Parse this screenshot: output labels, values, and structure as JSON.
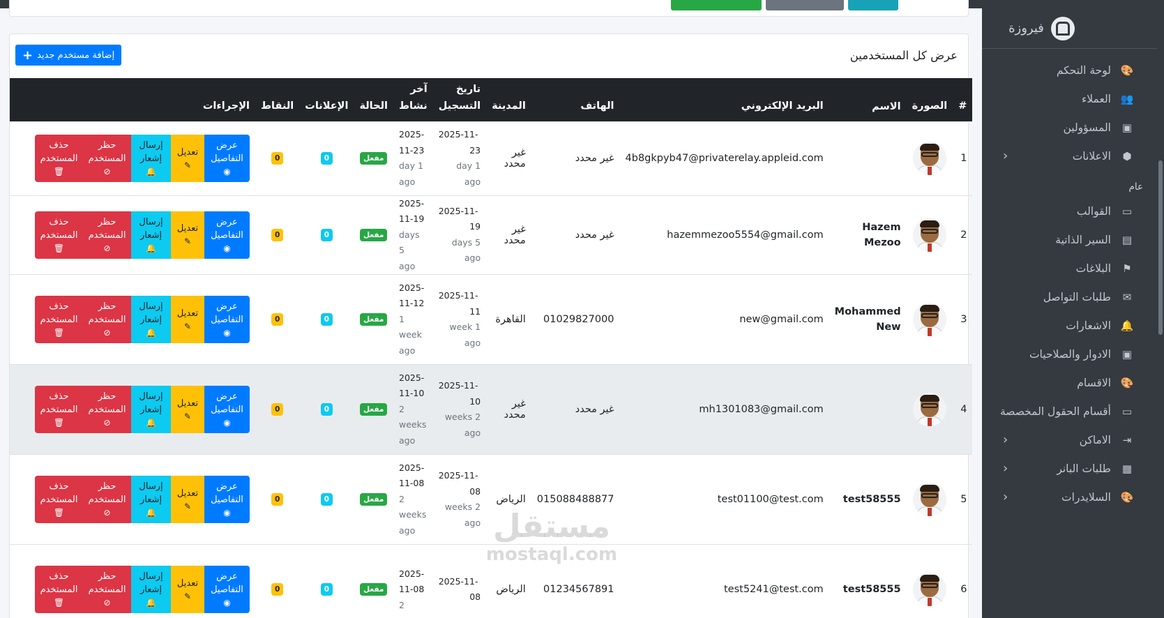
{
  "brand": {
    "name": "فيروزة"
  },
  "sidebar": {
    "items": [
      {
        "label": "لوحة التحكم",
        "icon": "palette-icon",
        "chev": false
      },
      {
        "label": "العملاء",
        "icon": "users-icon",
        "chev": false
      },
      {
        "label": "المسؤولين",
        "icon": "id-card-icon",
        "chev": false
      },
      {
        "label": "الاعلانات",
        "icon": "cube-icon",
        "chev": true
      }
    ],
    "header": "عام",
    "items2": [
      {
        "label": "القوالب",
        "icon": "folder-icon",
        "chev": false
      },
      {
        "label": "السير الذاتية",
        "icon": "file-user-icon",
        "chev": false
      },
      {
        "label": "البلاغات",
        "icon": "flag-icon",
        "chev": false
      },
      {
        "label": "طلبات التواصل",
        "icon": "envelope-icon",
        "chev": false
      },
      {
        "label": "الاشعارات",
        "icon": "bell-icon",
        "chev": false
      },
      {
        "label": "الادوار والصلاحيات",
        "icon": "id-badge-icon",
        "chev": false
      },
      {
        "label": "الاقسام",
        "icon": "palette-icon",
        "chev": false
      },
      {
        "label": "أقسام الحقول المخصصة",
        "icon": "folder-plus-icon",
        "chev": false
      },
      {
        "label": "الاماكن",
        "icon": "sign-in-icon",
        "chev": true
      },
      {
        "label": "طلبات البانر",
        "icon": "ad-icon",
        "chev": true
      },
      {
        "label": "السلايدرات",
        "icon": "palette-icon",
        "chev": true
      }
    ]
  },
  "card": {
    "title": "عرض كل المستخدمين",
    "add_label": "إضافة مستخدم جديد"
  },
  "table": {
    "headers": {
      "num": "#",
      "photo": "الصورة",
      "name": "الاسم",
      "email": "البريد الإلكتروني",
      "phone": "الهاتف",
      "city": "المدينة",
      "reg_l1": "تاريخ",
      "reg_l2": "التسجيل",
      "last_l1": "آخر",
      "last_l2": "نشاط",
      "status": "الحالة",
      "ads": "الإعلانات",
      "points": "النقاط",
      "actions": "الإجراءات"
    },
    "actions": {
      "view_l1": "عرض",
      "view_l2": "التفاصيل",
      "edit": "تعديل",
      "notify_l1": "إرسال",
      "notify_l2": "إشعار",
      "ban_l1": "حظر",
      "ban_l2": "المستخدم",
      "del_l1": "حذف",
      "del_l2": "المستخدم"
    },
    "rows": [
      {
        "num": "1",
        "name_l1": "",
        "name_l2": "",
        "email": "4b8gkpyb47@privaterelay.appleid.com",
        "phone": "غير محدد",
        "city": "غير محدد",
        "reg_a": "2025-11-",
        "reg_b": "23",
        "reg_c": "day 1",
        "reg_d": "ago",
        "last_a": "2025-",
        "last_b": "11-23",
        "last_c": "day 1",
        "last_d": "ago",
        "status": "مفعل",
        "ads": "0",
        "points": "0"
      },
      {
        "num": "2",
        "name_l1": "Hazem",
        "name_l2": "Mezoo",
        "email": "hazemmezoo5554@gmail.com",
        "phone": "غير محدد",
        "city": "غير محدد",
        "reg_a": "2025-11-",
        "reg_b": "19",
        "reg_c": "days 5",
        "reg_d": "ago",
        "last_a": "2025-",
        "last_b": "11-19",
        "last_c": "days 5",
        "last_d": "ago",
        "status": "مفعل",
        "ads": "0",
        "points": "0"
      },
      {
        "num": "3",
        "name_l1": "Mohammed",
        "name_l2": "New",
        "email": "new@gmail.com",
        "phone": "01029827000",
        "city": "القاهرة",
        "reg_a": "2025-11-",
        "reg_b": "11",
        "reg_c": "week 1",
        "reg_d": "ago",
        "last_a": "2025-",
        "last_b": "11-12",
        "last_c": "1",
        "last_d": "week",
        "last_e": "ago",
        "status": "مفعل",
        "ads": "0",
        "points": "0"
      },
      {
        "num": "4",
        "name_l1": "",
        "name_l2": "",
        "email": "mh1301083@gmail.com",
        "phone": "غير محدد",
        "city": "غير محدد",
        "reg_a": "2025-11-",
        "reg_b": "10",
        "reg_c": "weeks 2",
        "reg_d": "ago",
        "last_a": "2025-",
        "last_b": "11-10",
        "last_c": "2",
        "last_d": "weeks",
        "last_e": "ago",
        "status": "مفعل",
        "ads": "0",
        "points": "0"
      },
      {
        "num": "5",
        "name_l1": "test58555",
        "name_l2": "",
        "email": "test01100@test.com",
        "phone": "015088488877",
        "city": "الرياض",
        "reg_a": "2025-11-",
        "reg_b": "08",
        "reg_c": "weeks 2",
        "reg_d": "ago",
        "last_a": "2025-",
        "last_b": "11-08",
        "last_c": "2",
        "last_d": "weeks",
        "last_e": "ago",
        "status": "مفعل",
        "ads": "0",
        "points": "0"
      },
      {
        "num": "6",
        "name_l1": "test58555",
        "name_l2": "",
        "email": "test5241@test.com",
        "phone": "01234567891",
        "city": "الرياض",
        "reg_a": "2025-11-",
        "reg_b": "08",
        "reg_c": "",
        "reg_d": "",
        "last_a": "2025-",
        "last_b": "11-08",
        "last_c": "2",
        "last_d": "",
        "last_e": "",
        "status": "مفعل",
        "ads": "0",
        "points": "0"
      }
    ]
  },
  "watermark": {
    "ar": "مستقل",
    "en": "mostaql.com"
  },
  "colors": {
    "primary": "#007bff",
    "warning": "#ffc107",
    "info": "#0dcaf0",
    "danger": "#dc3545",
    "success": "#28a745",
    "sidebar": "#343a40"
  }
}
